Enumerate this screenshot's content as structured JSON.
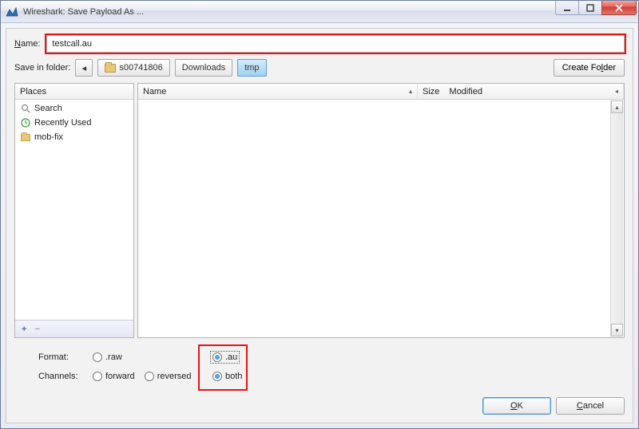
{
  "window": {
    "title": "Wireshark: Save Payload As ..."
  },
  "name_field": {
    "label_pre": "N",
    "label_post": "ame:",
    "value": "testcall.au"
  },
  "save_in_folder": {
    "label": "Save in folder:",
    "back_symbol": "◂",
    "crumbs": [
      {
        "label": "s00741806",
        "has_icon": true,
        "active": false
      },
      {
        "label": "Downloads",
        "has_icon": false,
        "active": false
      },
      {
        "label": "tmp",
        "has_icon": false,
        "active": true
      }
    ],
    "create_folder_pre": "Create Fo",
    "create_folder_u": "l",
    "create_folder_post": "der"
  },
  "places": {
    "header": "Places",
    "items": [
      {
        "name": "Search",
        "icon": "search-icon"
      },
      {
        "name": "Recently Used",
        "icon": "recent-icon"
      },
      {
        "name": "mob-fix",
        "icon": "folder-icon"
      }
    ],
    "add_symbol": "+",
    "remove_symbol": "−"
  },
  "file_list": {
    "col_name": "Name",
    "col_size": "Size",
    "col_modified": "Modified",
    "right_symbol": "◂",
    "sort_symbol": "▴",
    "up_symbol": "▴",
    "down_symbol": "▾"
  },
  "options": {
    "format_label": "Format:",
    "channels_label": "Channels:",
    "format": [
      {
        "label": ".raw",
        "selected": false
      },
      {
        "label": ".au",
        "selected": true
      }
    ],
    "channels": [
      {
        "label": "forward",
        "selected": false
      },
      {
        "label": "reversed",
        "selected": false
      },
      {
        "label": "both",
        "selected": true
      }
    ]
  },
  "buttons": {
    "ok_u": "O",
    "ok_post": "K",
    "cancel_u": "C",
    "cancel_post": "ancel"
  }
}
